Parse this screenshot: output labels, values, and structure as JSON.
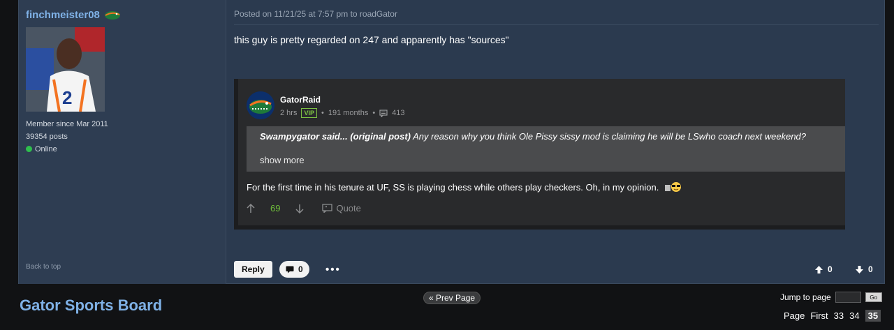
{
  "post": {
    "username": "finchmeister08",
    "member_since": "Member since Mar 2011",
    "posts": "39354 posts",
    "status": "Online",
    "back_to_top": "Back to top",
    "posted_line": "Posted on 11/21/25 at 7:57 pm to roadGator",
    "text": "this guy is pretty regarded on 247 and apparently has \"sources\""
  },
  "embed": {
    "author": "GatorRaid",
    "age": "2 hrs",
    "badge": "VIP",
    "tenure": "191 months",
    "post_count": "413",
    "orig_label": "Swampygator said... (original post)",
    "orig_text": "Any reason why you think Ole Pissy sissy mod is claiming he will be LSwho coach next weekend?",
    "show_more": "show more",
    "reply": "For the first time in his tenure at UF, SS is playing chess while others play checkers. Oh, in my opinion.",
    "votes": "69",
    "quote_label": "Quote"
  },
  "actions": {
    "reply_label": "Reply",
    "comment_count": "0",
    "more": "•••",
    "upvotes": "0",
    "downvotes": "0"
  },
  "footer": {
    "site_title": "Gator Sports Board",
    "prev_page": "« Prev Page",
    "jump_label": "Jump to page",
    "go_label": "Go",
    "page_label": "Page",
    "first_label": "First",
    "pages": [
      "33",
      "34"
    ],
    "current_page": "35"
  },
  "colors": {
    "accent": "#7fb1e6",
    "post_bg": "#2b3a4f",
    "online": "#2fbf4d",
    "vote_green": "#6fbf3a"
  }
}
